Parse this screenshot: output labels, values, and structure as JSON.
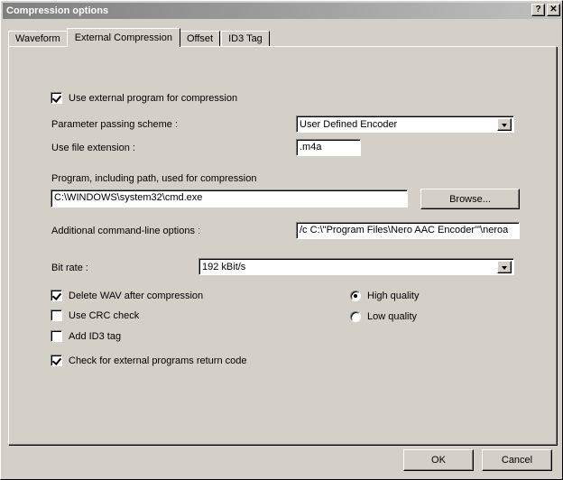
{
  "window": {
    "title": "Compression options",
    "title_buttons": [
      {
        "name": "help-button",
        "glyph": "?"
      },
      {
        "name": "close-button",
        "glyph": "✕"
      }
    ]
  },
  "tabs": [
    {
      "label": "Waveform",
      "active": false
    },
    {
      "label": "External Compression",
      "active": true
    },
    {
      "label": "Offset",
      "active": false
    },
    {
      "label": "ID3 Tag",
      "active": false
    }
  ],
  "form": {
    "use_external_checkbox": {
      "label": "Use external program for compression",
      "checked": true
    },
    "parameter_passing_scheme": {
      "label": "Parameter passing scheme :",
      "value": "User Defined Encoder"
    },
    "use_file_extension": {
      "label": "Use file extension :",
      "value": ".m4a"
    },
    "program_path": {
      "label": "Program, including path, used for compression",
      "value": "C:\\WINDOWS\\system32\\cmd.exe"
    },
    "browse_button": {
      "label": "Browse..."
    },
    "command_line_options": {
      "label": "Additional command-line options :",
      "value": "/c C:\\\"Program Files\\Nero AAC Encoder'\"\\neroa"
    },
    "bit_rate": {
      "label": "Bit rate :",
      "value": "192 kBit/s"
    },
    "checkboxes": [
      {
        "label": "Delete WAV after compression",
        "checked": true
      },
      {
        "label": "Use CRC check",
        "checked": false
      },
      {
        "label": "Add ID3 tag",
        "checked": false
      },
      {
        "label": "Check for external programs return code",
        "checked": true
      }
    ],
    "quality_radios": [
      {
        "label": "High quality",
        "selected": true
      },
      {
        "label": "Low quality",
        "selected": false
      }
    ]
  },
  "footer": {
    "ok_label": "OK",
    "cancel_label": "Cancel"
  },
  "colors": {
    "face": "#d4d0c8",
    "title_left": "#808080",
    "title_right": "#c0c0c0",
    "field_bg": "#ffffff"
  }
}
